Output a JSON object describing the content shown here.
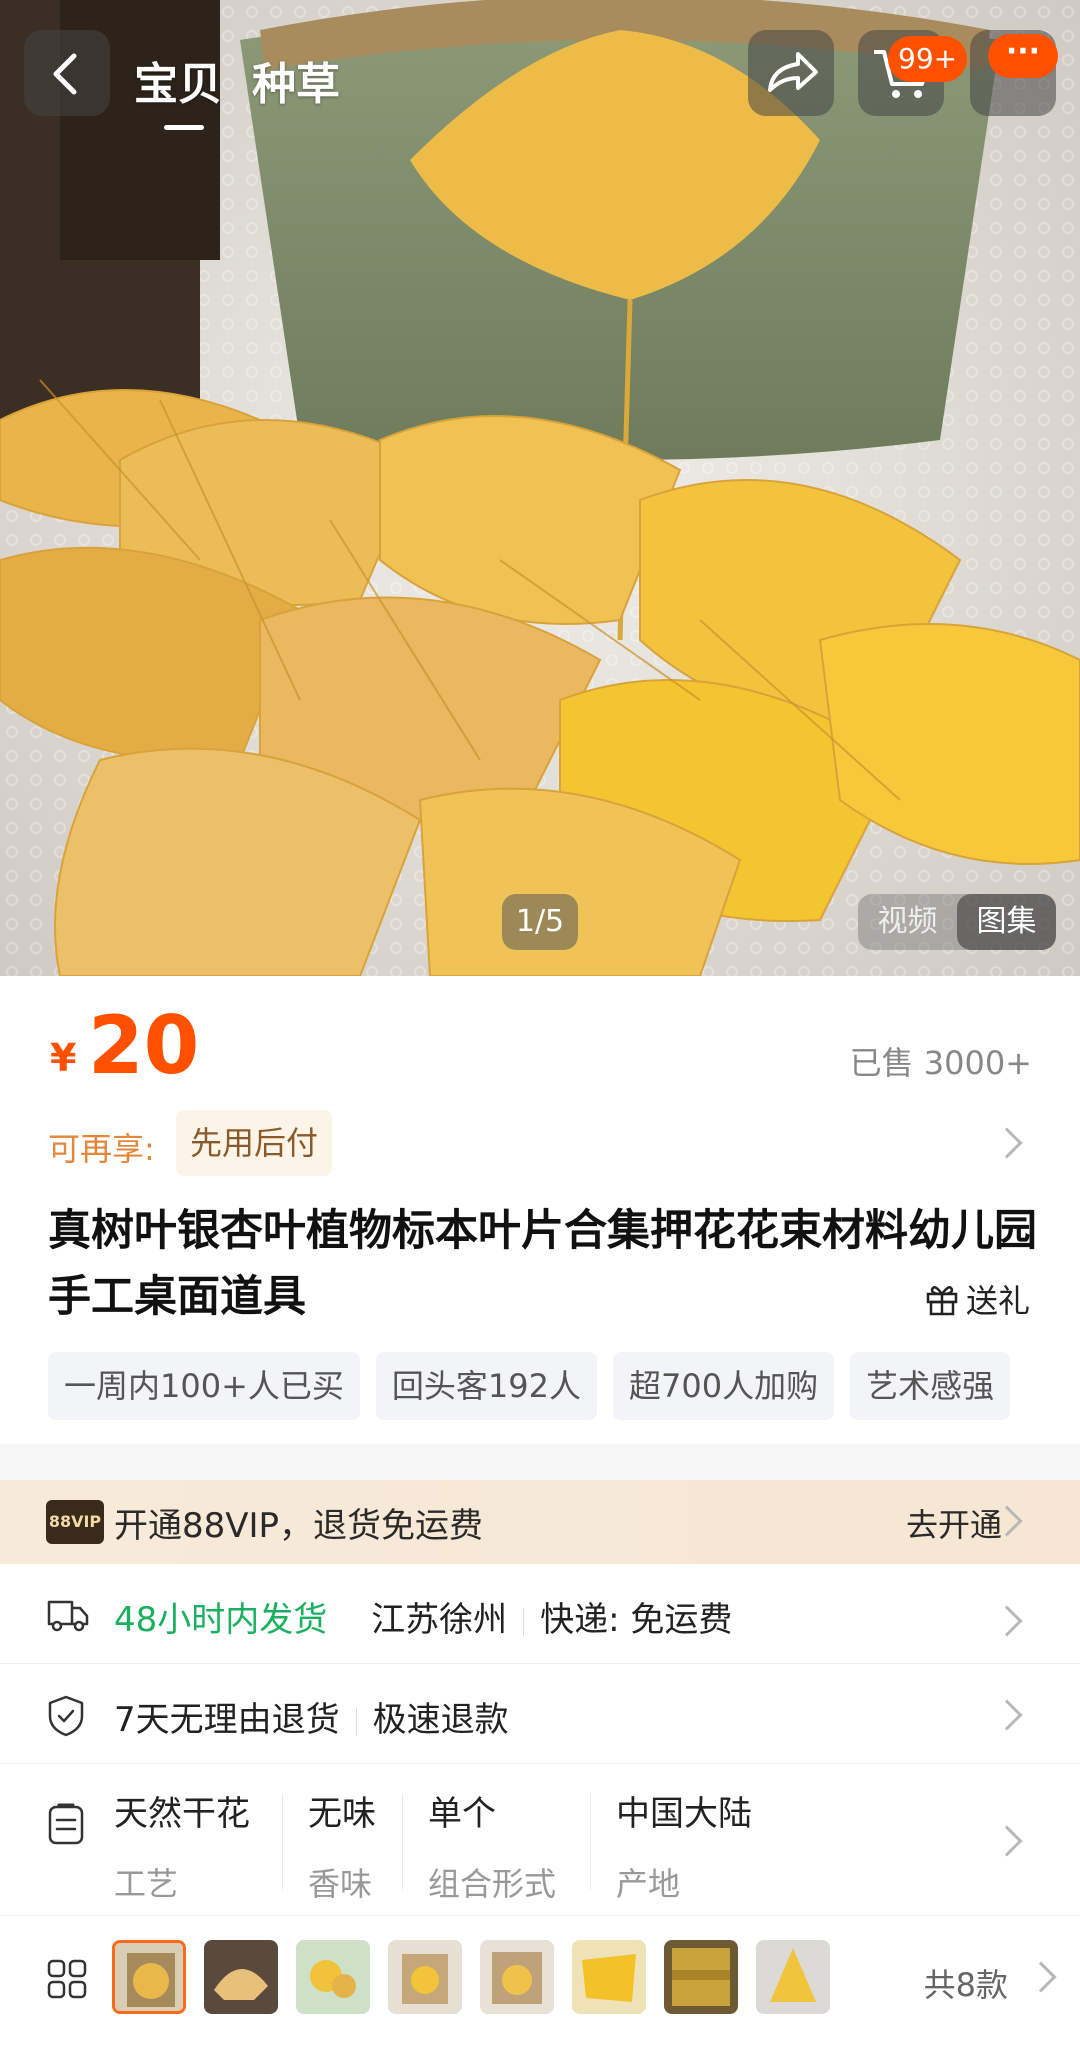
{
  "header": {
    "tabs": [
      "宝贝",
      "种草"
    ],
    "cart_badge": "99+",
    "more_badge": "···"
  },
  "gallery": {
    "pager": "1/5",
    "media_tabs": [
      "视频",
      "图集"
    ]
  },
  "price": {
    "currency": "¥",
    "amount": "20",
    "sold": "已售 3000+"
  },
  "promo": {
    "label": "可再享:",
    "tag": "先用后付"
  },
  "product": {
    "title": "真树叶银杏叶植物标本叶片合集押花花束材料幼儿园手工桌面道具",
    "gift_label": "送礼"
  },
  "tags": [
    "一周内100+人已买",
    "回头客192人",
    "超700人加购",
    "艺术感强"
  ],
  "vip": {
    "logo": "88VIP",
    "text": "开通88VIP，退货免运费",
    "action": "去开通"
  },
  "shipping": {
    "time": "48小时内发货",
    "origin": "江苏徐州",
    "delivery": "快递: 免运费"
  },
  "returns": {
    "policy": "7天无理由退货",
    "refund": "极速退款"
  },
  "attributes": [
    {
      "value": "天然干花",
      "key": "工艺"
    },
    {
      "value": "无味",
      "key": "香味"
    },
    {
      "value": "单个",
      "key": "组合形式"
    },
    {
      "value": "中国大陆",
      "key": "产地"
    }
  ],
  "variants": {
    "count_label": "共8款"
  },
  "colors": {
    "accent": "#ff5000",
    "green": "#1bb060",
    "leaf": "#e9b43a"
  }
}
